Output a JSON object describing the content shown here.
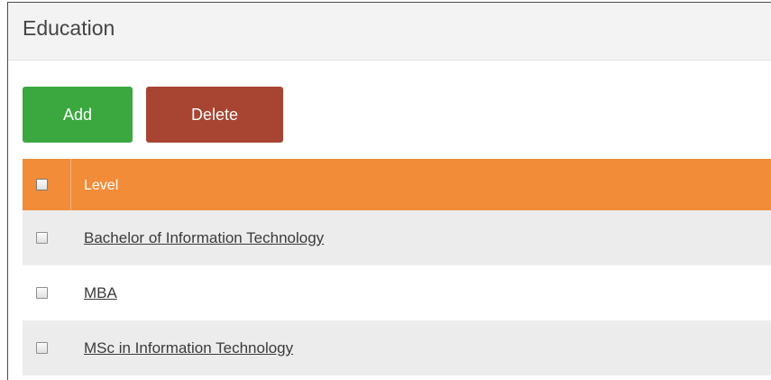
{
  "section": {
    "title": "Education"
  },
  "toolbar": {
    "add_label": "Add",
    "delete_label": "Delete"
  },
  "table": {
    "columns": [
      "Level"
    ],
    "rows": [
      {
        "level": "Bachelor of Information Technology"
      },
      {
        "level": "MBA"
      },
      {
        "level": "MSc in Information Technology"
      }
    ]
  },
  "colors": {
    "header_bg": "#f3f3f3",
    "add_button": "#3aa83f",
    "delete_button": "#a84432",
    "table_header": "#f28c38",
    "row_alt": "#ececec"
  }
}
